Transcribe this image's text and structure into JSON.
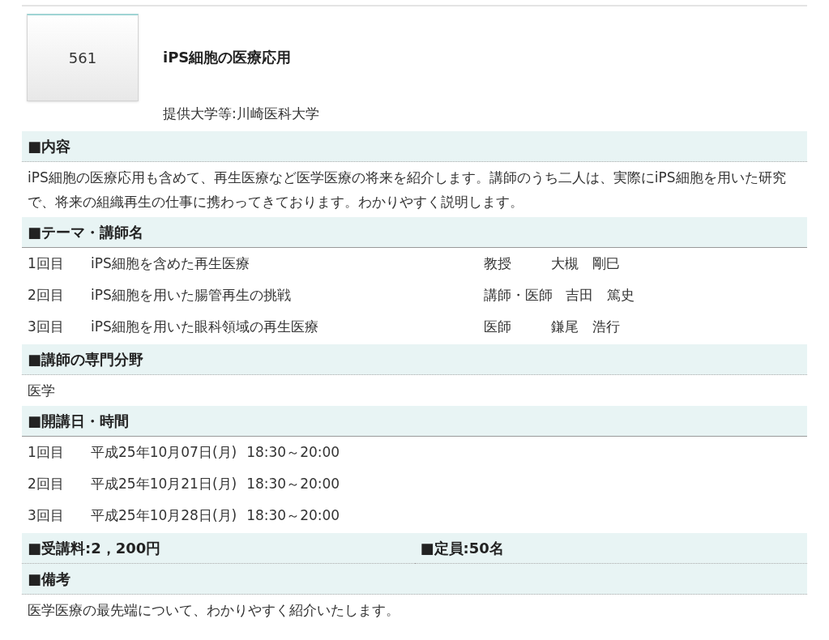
{
  "course": {
    "number": "561",
    "title": "iPS細胞の医療応用",
    "provider": "提供大学等:川崎医科大学"
  },
  "sections": [
    {
      "kind": "text",
      "heading": "■内容",
      "body": "iPS細胞の医療応用も含めて、再生医療など医学医療の将来を紹介します。講師のうち二人は、実際にiPS細胞を用いた研究で、将来の組織再生の仕事に携わってきております。わかりやすく説明します。"
    },
    {
      "kind": "lectures",
      "heading": "■テーマ・講師名",
      "rows": [
        {
          "session": "1回目",
          "theme": "iPS細胞を含めた再生医療",
          "role": "教授",
          "lecturer": "大槻　剛巳"
        },
        {
          "session": "2回目",
          "theme": "iPS細胞を用いた腸管再生の挑戦",
          "role": "講師・医師",
          "lecturer": "吉田　篤史"
        },
        {
          "session": "3回目",
          "theme": "iPS細胞を用いた眼科領域の再生医療",
          "role": "医師",
          "lecturer": "鎌尾　浩行"
        }
      ]
    },
    {
      "kind": "text",
      "heading": "■講師の専門分野",
      "body": "医学"
    },
    {
      "kind": "schedule",
      "heading": "■開講日・時間",
      "rows": [
        {
          "session": "1回目",
          "date": "平成25年10月07日(月)",
          "time": "18:30～20:00"
        },
        {
          "session": "2回目",
          "date": "平成25年10月21日(月)",
          "time": "18:30～20:00"
        },
        {
          "session": "3回目",
          "date": "平成25年10月28日(月)",
          "time": "18:30～20:00"
        }
      ]
    },
    {
      "kind": "pair",
      "items": [
        "■受講料:2，200円",
        "■定員:50名"
      ]
    },
    {
      "kind": "text",
      "heading": "■備考",
      "body": "医学医療の最先端について、わかりやすく紹介いたします。"
    }
  ]
}
